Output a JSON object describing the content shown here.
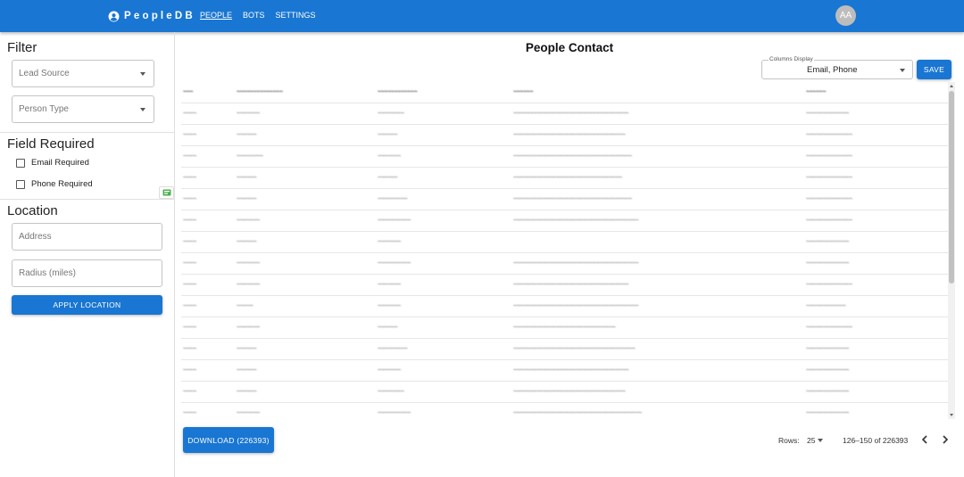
{
  "app": {
    "brand": "PeopleDB",
    "avatar_initials": "AA"
  },
  "nav": {
    "items": [
      "PEOPLE",
      "BOTS",
      "SETTINGS"
    ],
    "active": "PEOPLE"
  },
  "sidebar": {
    "filter_title": "Filter",
    "lead_source_label": "Lead Source",
    "person_type_label": "Person Type",
    "field_required_title": "Field Required",
    "email_required_label": "Email Required",
    "phone_required_label": "Phone Required",
    "location_title": "Location",
    "address_placeholder": "Address",
    "radius_placeholder": "Radius (miles)",
    "apply_location_label": "APPLY LOCATION"
  },
  "main": {
    "title": "People Contact",
    "columns_display_legend": "Columns Display",
    "columns_display_value": "Email, Phone",
    "save_label": "SAVE",
    "download_label": "DOWNLOAD (226393)"
  },
  "table": {
    "headers": [
      "~~~",
      "~~~~~~~~~~~~~~",
      "~~~~~~~~~~~~",
      "~~~~~~",
      "~~~~~~"
    ],
    "rows": [
      [
        "~~~~",
        "~~~~~~~",
        "~~~~~~~~",
        "~~~~~~~~~~~~~~~~~~~~~~~~~~~~~~~~~~~",
        "~~~~~~~~~~~~~"
      ],
      [
        "~~~~",
        "~~~~~~",
        "~~~~~~",
        "~~~~~~~~~~~~~~~~~~~~~~~~~~~~~~~~~~",
        "~~~~~~~~~~~~~~"
      ],
      [
        "~~~~",
        "~~~~~~~~",
        "~~~~~~~",
        "~~~~~~~~~~~~~~~~~~~~~~~~~~~~~~~~~~~~",
        "~~~~~~~~~~~~~~"
      ],
      [
        "~~~~",
        "~~~~~~",
        "~~~~~~",
        "~~~~~~~~~~~~~~~~~~~~~~~~~~~~~~~~~",
        "~~~~~~~~~~~~~~"
      ],
      [
        "~~~~",
        "~~~~~~",
        "~~~~~~~~~",
        "~~~~~~~~~~~~~~~~~~~~~~~~~~~~~~~~~~~~",
        "~~~~~~~~~~~~~~"
      ],
      [
        "~~~~",
        "~~~~~~~",
        "~~~~~~~~~~",
        "~~~~~~~~~~~~~~~~~~~~~~~~~~~~~~~~~~~~~~",
        "~~~~~~~~~~~~~~"
      ],
      [
        "~~~~",
        "~~~~~~",
        "~~~~~~~",
        "",
        "~~~~~~~~~~~~~"
      ],
      [
        "~~~~",
        "~~~~~~~",
        "~~~~~~~~~~",
        "~~~~~~~~~~~~~~~~~~~~~~~~~~~~~~~~~~~~~~",
        "~~~~~~~~~~~~~"
      ],
      [
        "~~~~",
        "~~~~~~~",
        "~~~~~~~",
        "~~~~~~~~~~~~~~~~~~~~~~~~~~~~~~~~~~~",
        "~~~~~~~~~~~~~~"
      ],
      [
        "~~~~",
        "~~~~~",
        "~~~~~~~",
        "~~~~~~~~~~~~~~~~~~~~~~~~~~~~~~~~~~~~~~",
        "~~~~~~~~~~~~"
      ],
      [
        "~~~~",
        "~~~~~~~",
        "~~~~~~",
        "~~~~~~~~~~~~~~~~~~~~~~~~~~~~~~~",
        "~~~~~~~~~~~~~~"
      ],
      [
        "~~~~",
        "~~~~~~",
        "~~~~~~~~~",
        "~~~~~~~~~~~~~~~~~~~~~~~~~~~~~~~~~~~~~",
        "~~~~~~~~~~~~~"
      ],
      [
        "~~~~",
        "~~~~~~",
        "~~~~~~~",
        "~~~~~~~~~~~~~~~~~~~~~~~~~~~~~~~~~~~",
        "~~~~~~~~~~~~~"
      ],
      [
        "~~~~",
        "~~~~~~",
        "~~~~~~~~",
        "~~~~~~~~~~~~~~~~~~~~~~~~~~~~~~~~~~",
        "~~~~~~~~~~~~~"
      ],
      [
        "~~~~",
        "~~~~~~~",
        "~~~~~~~~~~",
        "~~~~~~~~~~~~~~~~~~~~~~~~~~~~~~~~~~~~~~~",
        "~~~~~~~~~~~~~"
      ]
    ]
  },
  "pagination": {
    "rows_label": "Rows:",
    "rows_per_page": "25",
    "range": "126–150 of 226393"
  },
  "colors": {
    "primary": "#1976d2"
  },
  "icons": [
    "account-circle-icon",
    "chevron-down-icon",
    "checkbox-icon",
    "map-card-icon",
    "chevron-left-icon",
    "chevron-right-icon"
  ]
}
